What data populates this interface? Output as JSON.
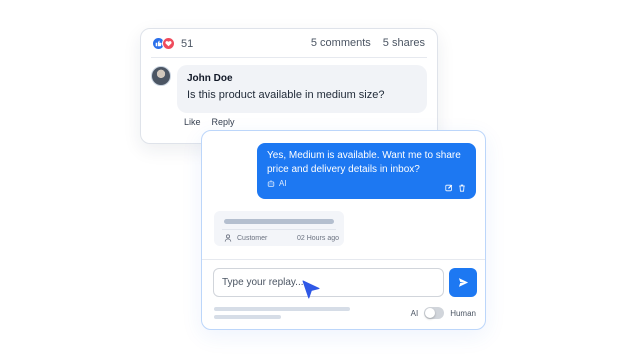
{
  "post": {
    "reaction_count": "51",
    "comments_label": "5 comments",
    "shares_label": "5 shares",
    "comment": {
      "author": "John Doe",
      "text": "Is this product available in medium size?"
    },
    "actions": {
      "like": "Like",
      "reply": "Reply"
    }
  },
  "chat": {
    "agent_message": {
      "text": "Yes, Medium is available. Want me to share price and delivery details in inbox?",
      "badge": "AI"
    },
    "customer_message": {
      "role": "Customer",
      "time": "02 Hours ago"
    },
    "reply": {
      "placeholder": "Type your replay..."
    },
    "mode": {
      "ai_label": "AI",
      "human_label": "Human"
    }
  },
  "colors": {
    "accent": "#1d78f2",
    "like_reaction": "#2a6fea",
    "love_reaction": "#ef4b5c"
  }
}
